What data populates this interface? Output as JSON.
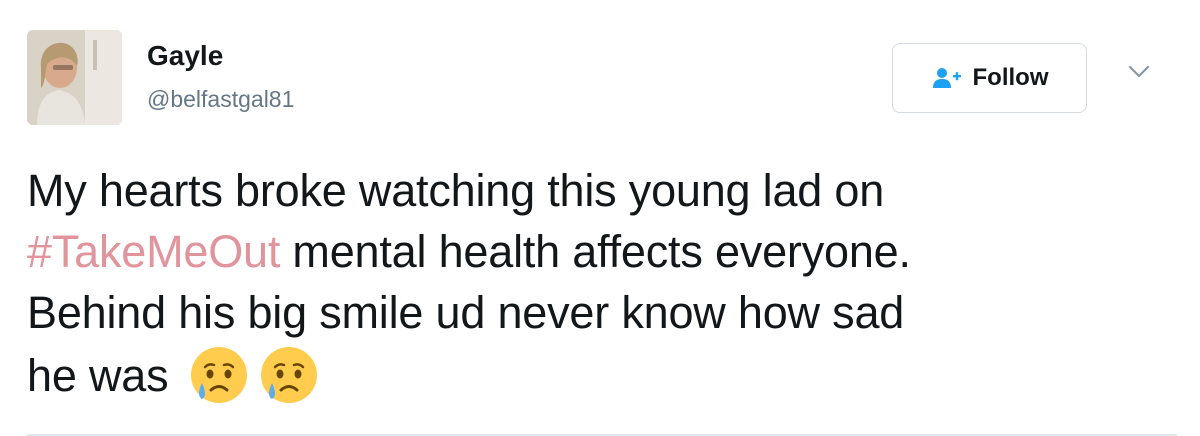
{
  "user": {
    "display_name": "Gayle",
    "handle": "@belfastgal81"
  },
  "actions": {
    "follow_label": "Follow",
    "follow_icon": "add-user-icon",
    "menu_icon": "chevron-down-icon"
  },
  "tweet": {
    "text_line1": "My hearts broke watching this young lad on",
    "hashtag": "#TakeMeOut",
    "text_after_hashtag": " mental health affects everyone.",
    "text_line3": "Behind his big smile ud never know how sad",
    "text_line4": "he was ",
    "emojis": [
      "crying-face-emoji",
      "crying-face-emoji"
    ]
  },
  "colors": {
    "hashtag": "#e0949c",
    "follow_icon": "#1da1f2",
    "text": "#14171a",
    "secondary_text": "#657786",
    "divider": "#e1e8ed"
  }
}
